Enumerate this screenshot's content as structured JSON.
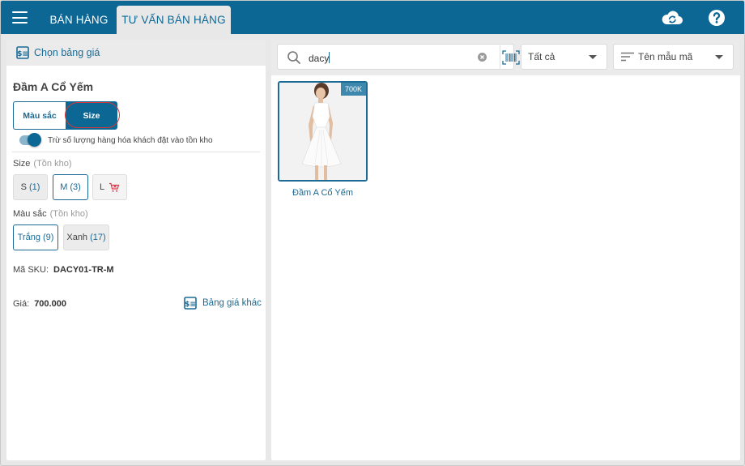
{
  "header": {
    "tabs": [
      {
        "label": "BÁN HÀNG",
        "active": false
      },
      {
        "label": "TƯ VẤN BÁN HÀNG",
        "active": true
      }
    ],
    "icons": [
      "menu-icon",
      "cloud-sync-icon",
      "help-icon"
    ]
  },
  "left": {
    "price_list_label": "Chọn bảng giá",
    "product_name": "Đầm A Cổ Yếm",
    "segments": [
      {
        "label": "Màu sắc",
        "selected": false
      },
      {
        "label": "Size",
        "selected": true
      }
    ],
    "toggle_label": "Trừ số lượng hàng hóa khách đặt vào tồn kho",
    "toggle_on": true,
    "size_section": {
      "label": "Size",
      "sub": "(Tồn kho)"
    },
    "sizes": [
      {
        "label": "S",
        "stock": "(1)"
      },
      {
        "label": "M",
        "stock": "(3)",
        "selected": true
      },
      {
        "label": "L",
        "stock": "",
        "out_of_stock_icon": "cart-remove-icon"
      }
    ],
    "color_section": {
      "label": "Màu sắc",
      "sub": "(Tồn kho)"
    },
    "colors": [
      {
        "label": "Trắng",
        "stock": "(9)",
        "selected": true
      },
      {
        "label": "Xanh",
        "stock": "(17)"
      }
    ],
    "sku_label": "Mã SKU:",
    "sku_value": "DACY01-TR-M",
    "price_label": "Giá:",
    "price_value": "700.000",
    "other_price_label": "Bảng giá khác"
  },
  "right": {
    "search": {
      "value": "dacy",
      "placeholder": ""
    },
    "filter": {
      "selected": "Tất cả"
    },
    "sort": {
      "selected": "Tên mẫu mã"
    },
    "products": [
      {
        "name": "Đầm A Cổ Yếm",
        "price_badge": "700K"
      }
    ]
  },
  "colors": {
    "primary": "#0d6794",
    "accent_text": "#1b6b96",
    "highlight_ring": "#d2393a",
    "out_of_stock_icon": "#e0394a"
  }
}
